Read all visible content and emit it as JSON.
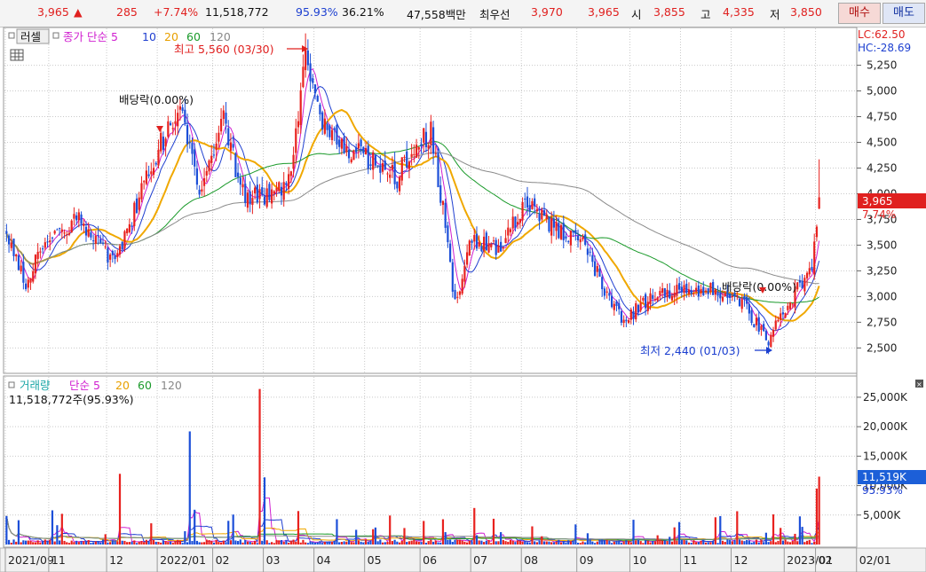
{
  "topbar": {
    "price": "3,965",
    "change": "285",
    "change_pct": "+7.74%",
    "volume": "11,518,772",
    "vol_ratio": "95.93%",
    "turnover": "36.21%",
    "amount": "47,558백만",
    "best_label": "최우선",
    "best_ask": "3,970",
    "best_bid": "3,965",
    "open_label": "시",
    "open": "3,855",
    "high_label": "고",
    "high": "4,335",
    "low_label": "저",
    "low": "3,850",
    "buy_label": "매수",
    "sell_label": "매도"
  },
  "chart_data": {
    "type": "candlestick",
    "price_panel": {
      "legend": [
        "러셀",
        "종가 단순 5",
        "10",
        "20",
        "60",
        "120"
      ],
      "ylim": [
        2270,
        5600
      ],
      "y_ticks": [
        2500,
        2750,
        3000,
        3250,
        3500,
        3750,
        4000,
        4250,
        4500,
        4750,
        5000,
        5250
      ],
      "y_tick_labels": [
        "2,500",
        "2,750",
        "3,000",
        "3,250",
        "3,500",
        "3,750",
        "4,000",
        "4,250",
        "4,500",
        "4,750",
        "5,000",
        "5,250"
      ],
      "lc_label": "LC:62.50",
      "hc_label": "HC:-28.69",
      "current_price_label": "3,965",
      "current_change_label": "7.74%",
      "annotations": {
        "high": "최고 5,560 (03/30)",
        "low": "최저 2,440 (01/03)",
        "dividend_1": "배당락(0.00%)",
        "dividend_2": "배당락(0.00%)"
      }
    },
    "volume_panel": {
      "legend": [
        "거래량",
        "단순 5",
        "20",
        "60",
        "120"
      ],
      "subtitle": "11,518,772주(95.93%)",
      "ylim": [
        0,
        28000
      ],
      "y_ticks": [
        5000,
        10000,
        15000,
        20000,
        25000
      ],
      "y_tick_labels": [
        "5,000K",
        "10,000K",
        "15,000K",
        "20,000K",
        "25,000K"
      ],
      "current_label": "11,519K",
      "current_ratio_label": "95.93%"
    },
    "x_labels": [
      "2021/09",
      "11",
      "12",
      "2022/01",
      "02",
      "03",
      "04",
      "05",
      "06",
      "07",
      "08",
      "09",
      "10",
      "11",
      "12",
      "2023/01",
      "02",
      "02/01"
    ],
    "n_bars": 338,
    "x_label_bars": [
      0,
      18,
      42,
      63,
      86,
      107,
      128,
      149,
      172,
      193,
      214,
      237,
      259,
      280,
      301,
      323,
      336,
      353
    ],
    "price_anchors": [
      [
        0,
        3580
      ],
      [
        8,
        3100
      ],
      [
        16,
        3550
      ],
      [
        30,
        3750
      ],
      [
        45,
        3300
      ],
      [
        60,
        4300
      ],
      [
        72,
        4850
      ],
      [
        80,
        3950
      ],
      [
        90,
        4700
      ],
      [
        98,
        4000
      ],
      [
        110,
        3970
      ],
      [
        118,
        4200
      ],
      [
        124,
        5450
      ],
      [
        130,
        4700
      ],
      [
        138,
        4450
      ],
      [
        150,
        4350
      ],
      [
        162,
        4150
      ],
      [
        168,
        4450
      ],
      [
        176,
        4600
      ],
      [
        182,
        3700
      ],
      [
        186,
        2930
      ],
      [
        192,
        3520
      ],
      [
        204,
        3480
      ],
      [
        216,
        3950
      ],
      [
        225,
        3700
      ],
      [
        240,
        3500
      ],
      [
        250,
        2940
      ],
      [
        256,
        2780
      ],
      [
        266,
        2950
      ],
      [
        280,
        3100
      ],
      [
        292,
        3060
      ],
      [
        305,
        2940
      ],
      [
        316,
        2560
      ],
      [
        322,
        2850
      ],
      [
        330,
        3150
      ],
      [
        334,
        3250
      ],
      [
        337,
        3965
      ]
    ],
    "last_bar": {
      "open": 3855,
      "high": 4335,
      "low": 3850,
      "close": 3965,
      "volume": 11519
    }
  }
}
